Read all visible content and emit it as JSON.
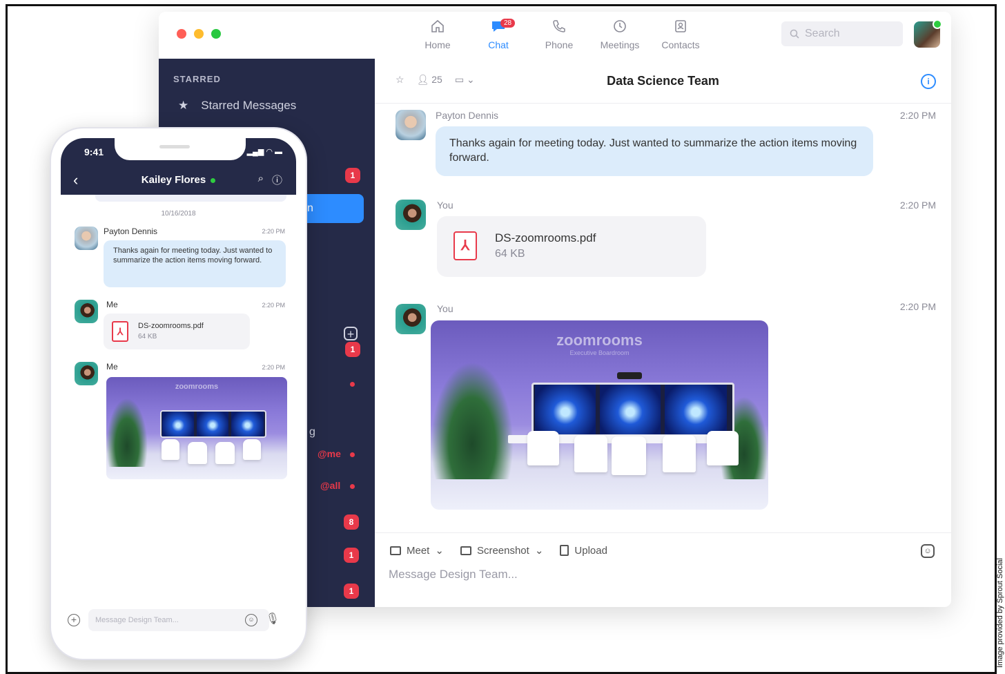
{
  "window_controls": {
    "colors": [
      "#ff5f57",
      "#febc2e",
      "#28c840"
    ]
  },
  "nav": {
    "tabs": [
      {
        "label": "Home",
        "icon": "home-icon"
      },
      {
        "label": "Chat",
        "icon": "chat-icon",
        "badge": "28"
      },
      {
        "label": "Phone",
        "icon": "phone-icon"
      },
      {
        "label": "Meetings",
        "icon": "clock-icon"
      },
      {
        "label": "Contacts",
        "icon": "contacts-icon"
      }
    ],
    "search_placeholder": "Search"
  },
  "sidebar": {
    "section_title": "STARRED",
    "starred_label": "Starred Messages",
    "selected_fragment": "n",
    "badges": [
      "1",
      "1",
      "8",
      "1",
      "1"
    ],
    "fragment_g": "g",
    "mention_me": "@me",
    "mention_all": "@all"
  },
  "chat": {
    "member_count": "25",
    "title": "Data Science Team",
    "messages": [
      {
        "sender": "Payton Dennis",
        "time": "2:20 PM",
        "text": "Thanks again for meeting today. Just wanted to summarize the action items moving forward."
      },
      {
        "sender": "You",
        "time": "2:20 PM",
        "file_name": "DS-zoomrooms.pdf",
        "file_size": "64 KB"
      },
      {
        "sender": "You",
        "time": "2:20 PM",
        "image": "zoomrooms-photo"
      }
    ],
    "composer": {
      "meet_label": "Meet",
      "screenshot_label": "Screenshot",
      "upload_label": "Upload",
      "placeholder": "Message Design Team..."
    }
  },
  "room_image": {
    "logo": "zoomrooms",
    "subtitle": "Executive Boardroom"
  },
  "phone": {
    "status_time": "9:41",
    "contact_name": "Kailey Flores",
    "date": "10/16/2018",
    "messages": [
      {
        "sender": "Payton Dennis",
        "time": "2:20 PM",
        "text": "Thanks again for meeting today. Just wanted to summarize the action items moving forward."
      },
      {
        "sender": "Me",
        "time": "2:20 PM",
        "file_name": "DS-zoomrooms.pdf",
        "file_size": "64 KB"
      },
      {
        "sender": "Me",
        "time": "2:20 PM",
        "image": "zoomrooms-photo"
      }
    ],
    "input_placeholder": "Message Design Team..."
  },
  "credit": "Image provided by Sprout Social"
}
